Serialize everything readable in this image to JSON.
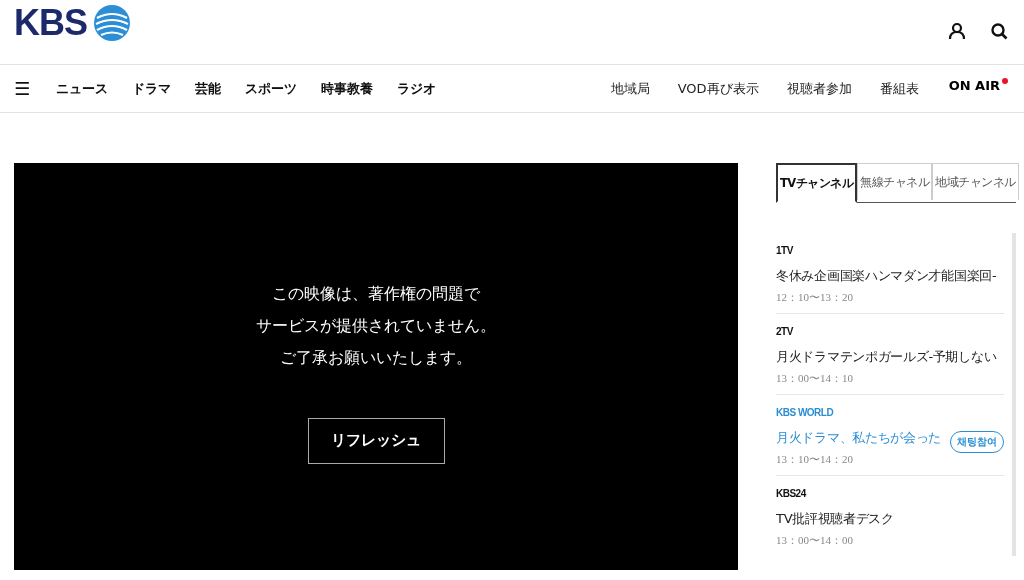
{
  "header": {
    "logo": "KBS"
  },
  "nav": {
    "menu_icon": "☰",
    "items": [
      {
        "label": "ニュース"
      },
      {
        "label": "ドラマ"
      },
      {
        "label": "芸能"
      },
      {
        "label": "スポーツ"
      },
      {
        "label": "時事教養"
      },
      {
        "label": "ラジオ"
      }
    ],
    "links": [
      {
        "label": "地域局"
      },
      {
        "label": "VOD再び表示"
      },
      {
        "label": "視聴者参加"
      },
      {
        "label": "番組表"
      }
    ],
    "on_air": "ON AIR"
  },
  "player": {
    "message": [
      "この映像は、著作権の問題で",
      "サービスが提供されていません。",
      "ご了承お願いいたします。"
    ],
    "button": "リフレッシュ"
  },
  "sidebar": {
    "tabs": [
      {
        "label": "TVチャンネル",
        "selected": true
      },
      {
        "label": "無線チャネル",
        "selected": false
      },
      {
        "label": "地域チャンネル",
        "selected": false
      }
    ],
    "channels": [
      {
        "name": "1TV",
        "title": "冬休み企画国楽ハンマダン才能国楽回-",
        "time": "12：10〜13：20",
        "selected": false
      },
      {
        "name": "2TV",
        "title": "月火ドラマテンポガールズ-予期しない",
        "time": "13：00〜14：10",
        "selected": false
      },
      {
        "name": "KBS WORLD",
        "title": "月火ドラマ、私たちが会った",
        "time": "13：10〜14：20",
        "selected": true,
        "chat": "채팅참여"
      },
      {
        "name": "KBS24",
        "title": "TV批評視聴者デスク",
        "time": "13：00〜14：00",
        "selected": false
      }
    ]
  }
}
